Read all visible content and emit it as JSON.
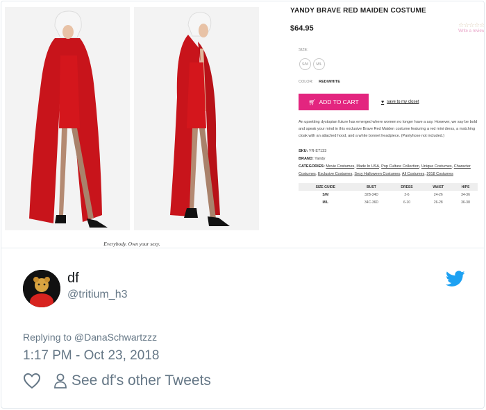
{
  "product": {
    "title": "YANDY BRAVE RED MAIDEN COSTUME",
    "price": "$64.95",
    "stars": "☆☆☆☆☆",
    "review_link": "Write a review",
    "size_label": "SIZE:",
    "sizes": [
      "S/M",
      "M/L"
    ],
    "color_label": "COLOR:",
    "color_value": "RED/WHITE",
    "cart_button": "ADD TO CART",
    "closet_link": "save to my closet",
    "description": "An upsetting dystopian future has emerged where women no longer have a say. However, we say be bold and speak your mind in this exclusive Brave Red Maiden costume featuring a red mini dress, a matching cloak with an attached hood, and a white bonnet headpiece. (Pantyhose not included.)",
    "sku_label": "SKU:",
    "sku": "YR-E7133",
    "brand_label": "BRAND:",
    "brand": "Yandy",
    "categories_label": "CATEGORIES:",
    "categories": [
      "Movie Costumes",
      "Made In USA",
      "Pop Culture Collection",
      "Unique Costumes",
      "Character Costumes",
      "Exclusive Costumes",
      "Sexy Halloween Costumes",
      "All Costumes",
      "2018 Costumes"
    ],
    "size_guide": {
      "headers": [
        "SIZE GUIDE",
        "BUST",
        "DRESS",
        "WAIST",
        "HIPS"
      ],
      "rows": [
        [
          "S/M",
          "32B-34D",
          "2-6",
          "24-26",
          "34-36"
        ],
        [
          "M/L",
          "34C-36D",
          "6-10",
          "26-28",
          "36-38"
        ]
      ]
    },
    "caption": "Everybody. Own your sexy."
  },
  "tweet": {
    "name": "df",
    "handle": "@tritium_h3",
    "replying_to": "Replying to @DanaSchwartzzz",
    "timestamp": "1:17 PM - Oct 23, 2018",
    "other_tweets": "See df's other Tweets"
  },
  "icons": {
    "bird": "twitter-bird-icon",
    "like": "heart-outline-icon",
    "person": "person-icon",
    "cart": "cart-icon"
  },
  "colors": {
    "twitter_blue": "#1da1f2",
    "cart_pink": "#e3257f",
    "muted_text": "#657786",
    "costume_red": "#d4161c"
  }
}
